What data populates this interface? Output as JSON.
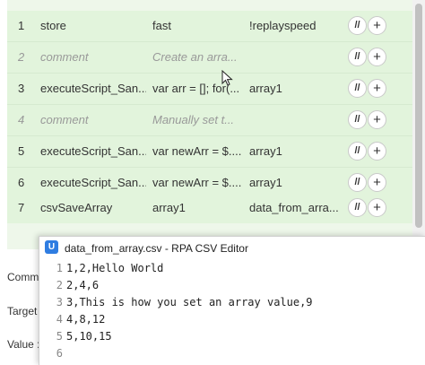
{
  "table": {
    "rows": [
      {
        "num": "1",
        "command": "store",
        "target": "fast",
        "value": "!replayspeed",
        "comment": false
      },
      {
        "num": "2",
        "command": "comment",
        "target": "Create an arra...",
        "value": "",
        "comment": true
      },
      {
        "num": "3",
        "command": "executeScript_San...",
        "target": "var arr = []; for(...",
        "value": "array1",
        "comment": false
      },
      {
        "num": "4",
        "command": "comment",
        "target": "Manually set t...",
        "value": "",
        "comment": true
      },
      {
        "num": "5",
        "command": "executeScript_San...",
        "target": "var newArr = $....",
        "value": "array1",
        "comment": false
      },
      {
        "num": "6",
        "command": "executeScript_San...",
        "target": "var newArr = $....",
        "value": "array1",
        "comment": false
      },
      {
        "num": "7",
        "command": "csvSaveArray",
        "target": "array1",
        "value": "data_from_arra...",
        "comment": false
      }
    ],
    "comment_btn": "//",
    "add_btn": "+"
  },
  "form": {
    "command_label": "Comm",
    "target_label": "Target",
    "value_label": "Value :"
  },
  "csv_editor": {
    "app_icon": "U",
    "title": "data_from_array.csv - RPA CSV Editor",
    "lines": [
      {
        "num": "1",
        "text": "1,2,Hello World"
      },
      {
        "num": "2",
        "text": "2,4,6"
      },
      {
        "num": "3",
        "text": "3,This is how you set an array value,9"
      },
      {
        "num": "4",
        "text": "4,8,12"
      },
      {
        "num": "5",
        "text": "5,10,15"
      },
      {
        "num": "6",
        "text": ""
      }
    ]
  },
  "icons": {
    "cursor": "mouse-pointer",
    "app": "rpa-csv-editor-icon"
  },
  "colors": {
    "row_bg": "#e2f4dc",
    "comment_text": "#999999",
    "app_icon": "#2f7de1"
  }
}
